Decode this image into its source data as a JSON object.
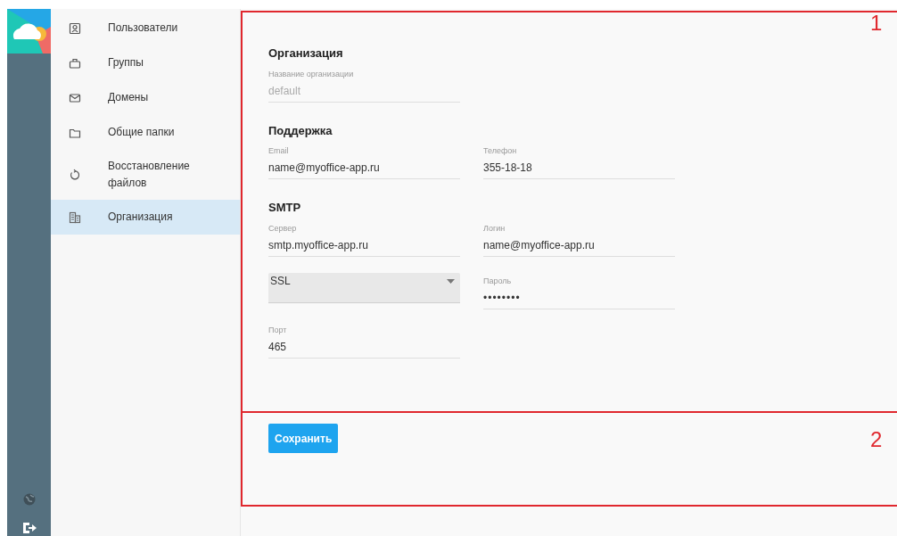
{
  "nav": {
    "items": [
      {
        "label": "Пользователи",
        "selected": false
      },
      {
        "label": "Группы",
        "selected": false
      },
      {
        "label": "Домены",
        "selected": false
      },
      {
        "label": "Общие папки",
        "selected": false
      },
      {
        "label": "Восстановление файлов",
        "selected": false
      },
      {
        "label": "Организация",
        "selected": true
      }
    ]
  },
  "sections": [
    {
      "title": "Организация",
      "fields": [
        {
          "kind": "text",
          "label": "Название организации",
          "value": "default",
          "disabled": true
        }
      ]
    },
    {
      "title": "Поддержка",
      "fields": [
        {
          "kind": "text",
          "label": "Email",
          "value": "name@myoffice-app.ru",
          "disabled": false
        },
        {
          "kind": "text",
          "label": "Телефон",
          "value": "355-18-18",
          "disabled": false
        }
      ]
    },
    {
      "title": "SMTP",
      "fields": [
        {
          "kind": "text",
          "label": "Сервер",
          "value": "smtp.myoffice-app.ru",
          "disabled": false
        },
        {
          "kind": "text",
          "label": "Логин",
          "value": "name@myoffice-app.ru",
          "disabled": false
        },
        {
          "kind": "select",
          "value": "SSL"
        },
        {
          "kind": "password",
          "label": "Пароль",
          "value": "••••••••",
          "disabled": false
        },
        {
          "kind": "text",
          "label": "Порт",
          "value": "465",
          "disabled": false
        }
      ]
    }
  ],
  "save_button": "Сохранить",
  "callouts": [
    {
      "label": "1"
    },
    {
      "label": "2"
    }
  ]
}
